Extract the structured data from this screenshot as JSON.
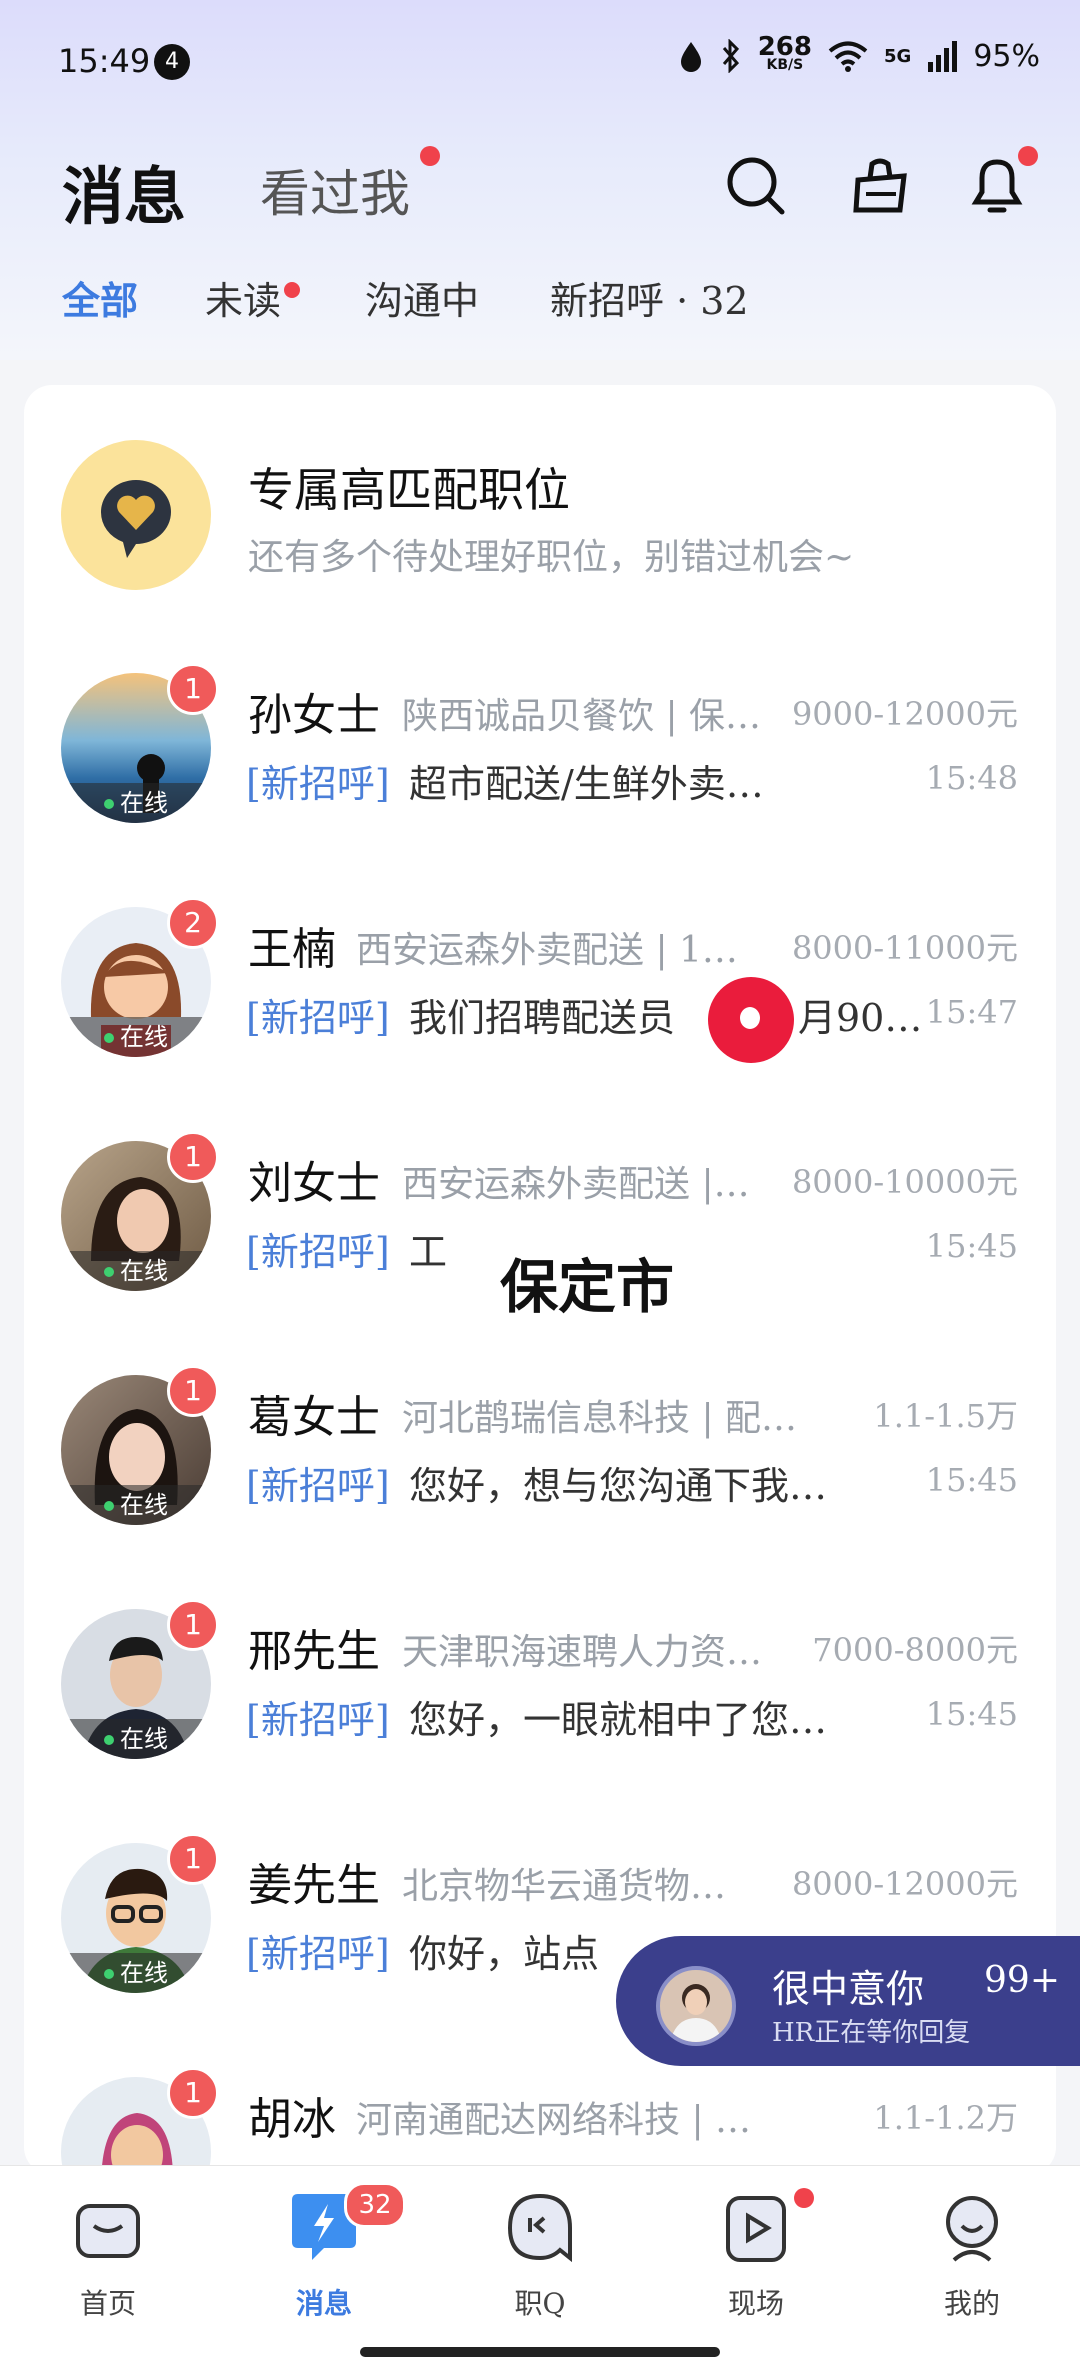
{
  "status_bar": {
    "time": "15:49",
    "notification_count": "4",
    "net_speed_top": "268",
    "net_speed_bottom": "KB/S",
    "signal": "5G",
    "battery": "95%"
  },
  "header": {
    "title": "消息",
    "seen_me": "看过我"
  },
  "tabs": [
    {
      "label": "全部",
      "active": true
    },
    {
      "label": "未读"
    },
    {
      "label": "沟通中"
    },
    {
      "label": "新招呼 · 32"
    }
  ],
  "promo": {
    "title": "专属高匹配职位",
    "subtitle": "还有多个待处理好职位，别错过机会~"
  },
  "online_label": "在线",
  "messages": [
    {
      "name": "孙女士",
      "company": "陕西诚品贝餐饮 | 保…",
      "salary": "9000-12000元",
      "tag": "[新招呼]",
      "message": "超市配送/生鲜外卖…",
      "time": "15:48",
      "unread": "1"
    },
    {
      "name": "王楠",
      "company": "西安运森外卖配送 | 10…",
      "salary": "8000-11000元",
      "tag": "[新招呼]",
      "message": "我们招聘配送员",
      "message_tail": "月90…",
      "time": "15:47",
      "unread": "2"
    },
    {
      "name": "刘女士",
      "company": "西安运森外卖配送 |…",
      "salary": "8000-10000元",
      "tag": "[新招呼]",
      "message": "工",
      "time": "15:45",
      "unread": "1"
    },
    {
      "name": "葛女士",
      "company": "河北鹊瑞信息科技 | 配…",
      "salary": "1.1-1.5万",
      "tag": "[新招呼]",
      "message": "您好，想与您沟通下我们…",
      "time": "15:45",
      "unread": "1"
    },
    {
      "name": "邢先生",
      "company": "天津职海速聘人力资…",
      "salary": "7000-8000元",
      "tag": "[新招呼]",
      "message": "您好，一眼就相中了您的…",
      "time": "15:45",
      "unread": "1"
    },
    {
      "name": "姜先生",
      "company": "北京物华云通货物…",
      "salary": "8000-12000元",
      "tag": "[新招呼]",
      "message": "你好，站点",
      "time": "",
      "unread": "1"
    },
    {
      "name": "胡冰",
      "company": "河南通配达网络科技 | 茶…",
      "salary": "1.1-1.2万",
      "tag": "",
      "message": "",
      "time": "",
      "unread": "1"
    }
  ],
  "overlay_text": "保定市",
  "floating_bar": {
    "title": "很中意你",
    "subtitle": "HR正在等你回复",
    "count": "99+"
  },
  "bottom_nav": [
    {
      "label": "首页"
    },
    {
      "label": "消息",
      "badge": "32",
      "active": true
    },
    {
      "label": "职Q"
    },
    {
      "label": "现场"
    },
    {
      "label": "我的"
    }
  ],
  "colors": {
    "accent": "#3d7be0",
    "badge_red": "#f05a5a",
    "tag_blue": "#4b7fd8"
  }
}
